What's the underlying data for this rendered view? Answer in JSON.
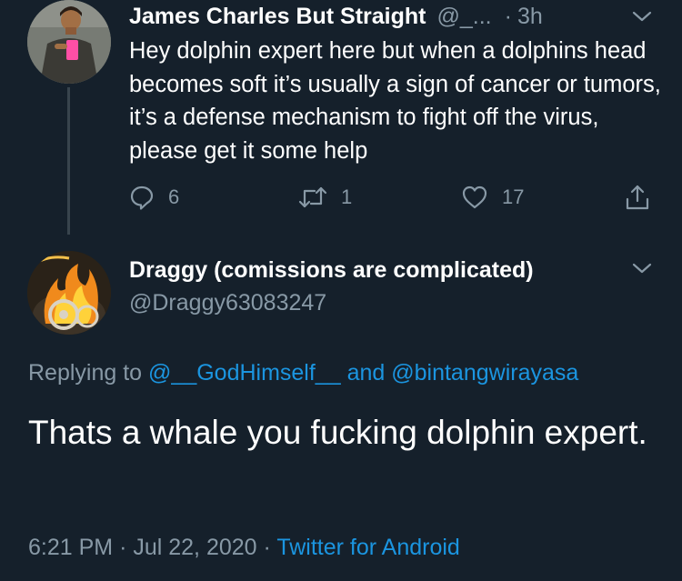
{
  "parent_tweet": {
    "display_name": "James Charles But Straight",
    "handle": "@_...",
    "separator": "·",
    "time": "3h",
    "text": "Hey dolphin expert here but when a dolphins head becomes soft it’s usually a sign of cancer or tumors, it’s a defense mechanism to fight off the virus, please get it some help",
    "actions": {
      "reply_count": "6",
      "retweet_count": "1",
      "like_count": "17"
    },
    "avatar_icon": "user-avatar-icon",
    "menu_icon": "chevron-down-icon"
  },
  "reply_tweet": {
    "display_name": "Draggy (comissions are complicated)",
    "handle": "@Draggy63083247",
    "replying_prefix": "Replying to",
    "mention_1": "@__GodHimself__",
    "and_word": "and",
    "mention_2": "@bintangwirayasa",
    "text": "Thats a whale you fucking dolphin expert.",
    "time": "6:21 PM",
    "sep_1": "·",
    "date": "Jul 22, 2020",
    "sep_2": "·",
    "source": "Twitter for Android",
    "avatar_icon": "flaming-wheel-avatar-icon",
    "menu_icon": "chevron-down-icon"
  },
  "colors": {
    "background": "#15202b",
    "primary_text": "#ffffff",
    "secondary_text": "#8899a6",
    "link": "#1b95e0",
    "thread_line": "#38444d"
  },
  "icons": [
    "reply-icon",
    "retweet-icon",
    "like-icon",
    "share-icon"
  ]
}
